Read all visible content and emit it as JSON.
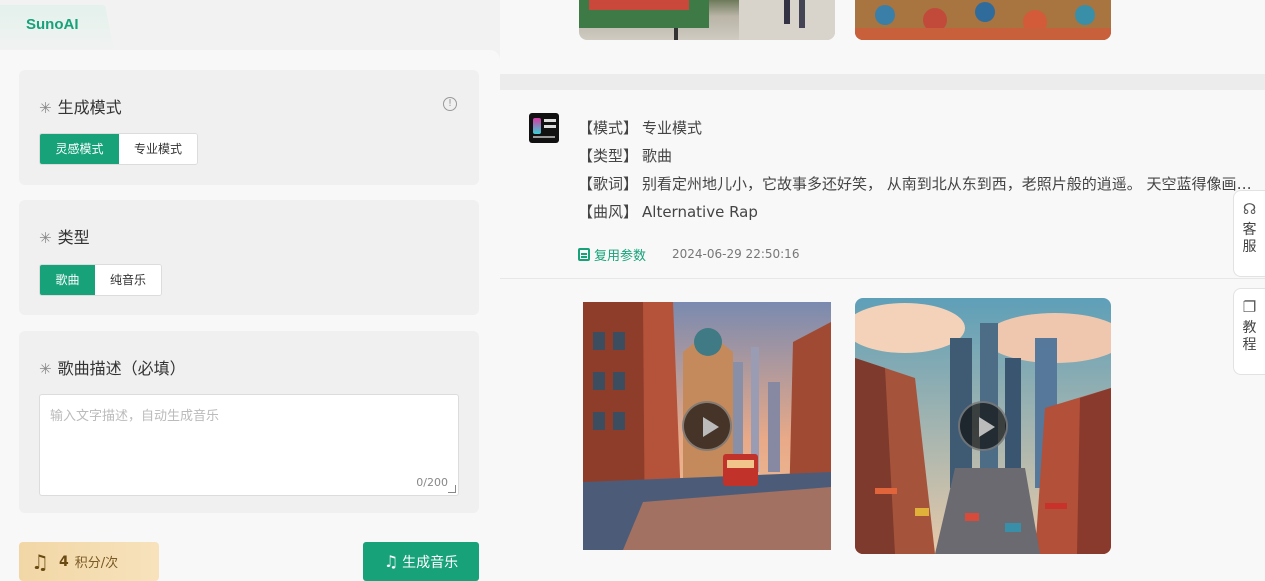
{
  "app": {
    "tab_label": "SunoAI"
  },
  "panel": {
    "mode_section": {
      "title": "生成模式",
      "options": [
        "灵感模式",
        "专业模式"
      ],
      "selected": "灵感模式"
    },
    "type_section": {
      "title": "类型",
      "options": [
        "歌曲",
        "纯音乐"
      ],
      "selected": "歌曲"
    },
    "desc_section": {
      "title": "歌曲描述（必填）",
      "placeholder": "输入文字描述，自动生成音乐",
      "counter": "0/200"
    },
    "points": {
      "value": "4",
      "unit": "积分/次"
    },
    "generate_label": "生成音乐"
  },
  "record": {
    "mode": {
      "key": "【模式】",
      "value": "专业模式"
    },
    "type": {
      "key": "【类型】",
      "value": "歌曲"
    },
    "lyrics": {
      "key": "【歌词】",
      "value": "别看定州地儿小，它故事多还好笑， 从南到北从东到西，老照片般的逍遥。 天空蓝得像画布，那云朵像白菜包。"
    },
    "style": {
      "key": "【曲风】",
      "value": "Alternative Rap"
    },
    "reuse_label": "复用参数",
    "timestamp": "2024-06-29 22:50:16"
  },
  "side": {
    "service_label": "客服",
    "tutorial_label": "教程"
  },
  "colors": {
    "accent": "#17a27a",
    "points_bg": "#f2d7a6"
  },
  "icons": [
    "info-icon",
    "music-note-icon",
    "reuse-icon",
    "play-icon",
    "headset-icon",
    "book-icon"
  ]
}
